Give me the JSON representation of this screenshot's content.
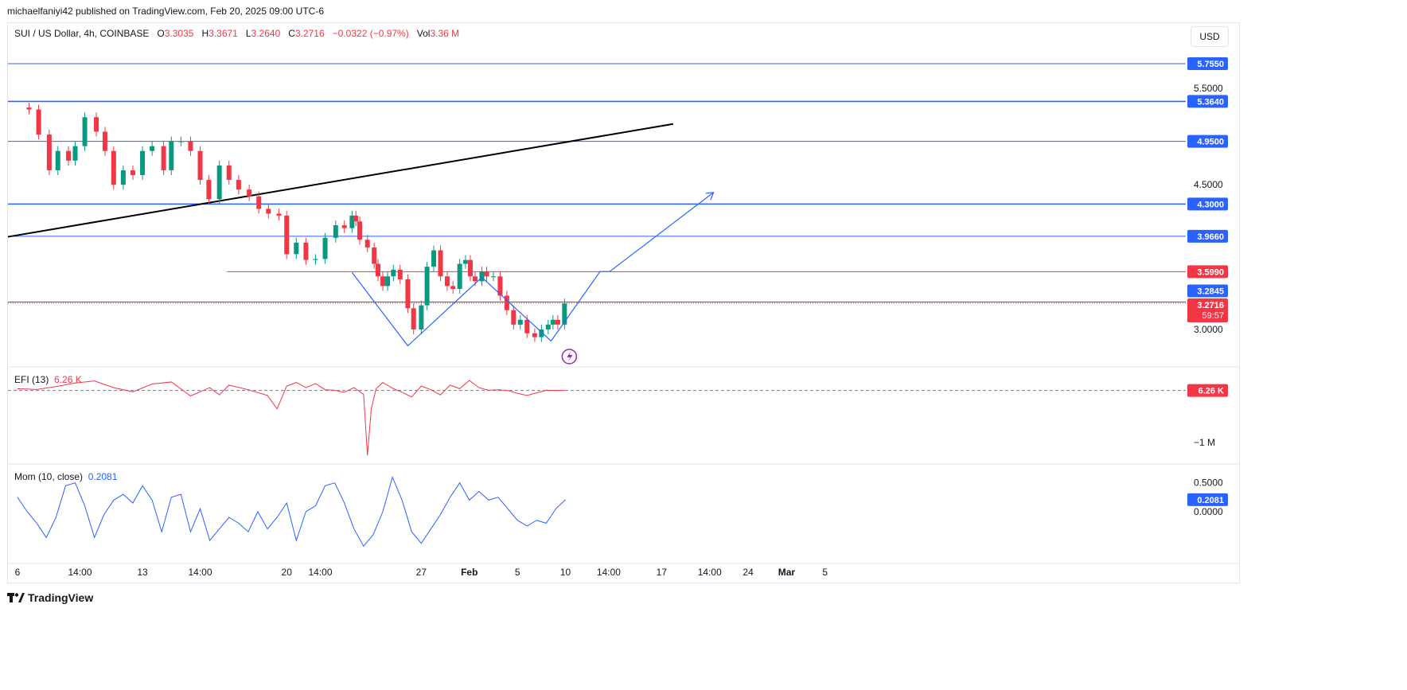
{
  "publisher": "michaelfaniyi42 published on TradingView.com, Feb 20, 2025 09:00 UTC-6",
  "legend": {
    "symbol": "SUI / US Dollar, 4h, COINBASE",
    "o_label": "O",
    "o": "3.3035",
    "h_label": "H",
    "h": "3.3671",
    "l_label": "L",
    "l": "3.2640",
    "c_label": "C",
    "c": "3.2716",
    "change": "−0.0322 (−0.97%)",
    "vol_label": "Vol",
    "vol": "3.36 M"
  },
  "currency_button": "USD",
  "efi": {
    "label": "EFI (13)",
    "value": "6.26 K"
  },
  "mom": {
    "label": "Mom (10, close)",
    "value": "0.2081"
  },
  "footer": {
    "brand": "TradingView",
    "logo": "tradingview-logo-icon"
  },
  "indicator_icon": "lightning-icon",
  "colors": {
    "up": "#089981",
    "down": "#f23645",
    "level": "#2962ff",
    "resistance": "#f23645",
    "trend": "#000000",
    "efi": "#f23645",
    "mom": "#2962ff"
  },
  "chart_data": [
    {
      "type": "candlestick",
      "title": "SUI / US Dollar, 4h, COINBASE",
      "ylim": [
        2.62,
        5.92
      ],
      "y_ticks": [
        "5.5000",
        "4.5000",
        "3.0000"
      ],
      "x_ticks": [
        "6",
        "14:00",
        "13",
        "14:00",
        "20",
        "14:00",
        "27",
        "Feb",
        "5",
        "10",
        "14:00",
        "17",
        "14:00",
        "24",
        "Mar",
        "5"
      ],
      "x_tick_dates": [
        0,
        6.5,
        13,
        19,
        28,
        31.5,
        42,
        47,
        52,
        57,
        61.5,
        67,
        72,
        76,
        80,
        84
      ],
      "horizontal_levels": [
        {
          "label": "5.7550",
          "value": 5.755
        },
        {
          "label": "5.3640",
          "value": 5.364
        },
        {
          "label": "4.9500",
          "value": 4.95
        },
        {
          "label": "4.3000",
          "value": 4.3
        },
        {
          "label": "3.9660",
          "value": 3.966
        }
      ],
      "resistance_line": {
        "label": "3.5990",
        "value": 3.599,
        "from": 21.8
      },
      "current_price": {
        "label": "3.2716",
        "value": 3.2716,
        "countdown": "59:57"
      },
      "blue_tag": {
        "label": "3.2845",
        "value": 3.2845
      },
      "trend_line": {
        "x": [
          0,
          68.2
        ],
        "y": [
          3.96,
          5.13
        ]
      },
      "pattern_path": {
        "x": [
          34.8,
          40.6,
          48.3,
          55.5,
          60.6,
          61.6,
          72.4
        ],
        "y": [
          3.59,
          2.83,
          3.54,
          2.88,
          3.6,
          3.6,
          4.42
        ]
      },
      "close_path": {
        "x": [
          0,
          1.2,
          2.2,
          3.3,
          4.2,
          5.3,
          6.0,
          7.0,
          8.2,
          9.1,
          10.0,
          11.0,
          12.0,
          13.0,
          14.0,
          15.2,
          16.0,
          17.0,
          18.0,
          19.0,
          19.9,
          21.0,
          22.0,
          23.0,
          24.1,
          25.1,
          26.1,
          27.2,
          28.0,
          29.0,
          30.0,
          31.0,
          32.0,
          33.1,
          34.0,
          34.8,
          35.2,
          35.6,
          36.4,
          37.1,
          37.5,
          38.0,
          38.5,
          39.1,
          39.8,
          40.6,
          41.2,
          42.0,
          42.6,
          43.3,
          44.0,
          44.7,
          45.3,
          46.0,
          46.6,
          47.1,
          47.6,
          48.3,
          48.8,
          49.5,
          50.2,
          50.9,
          51.6,
          52.3,
          53.0,
          53.8,
          54.5,
          55.2,
          55.7,
          56.2,
          56.9
        ],
        "y": [
          5.3,
          5.28,
          5.02,
          4.65,
          4.85,
          4.75,
          4.9,
          5.2,
          5.05,
          4.85,
          4.5,
          4.65,
          4.6,
          4.85,
          4.9,
          4.65,
          4.95,
          4.95,
          4.85,
          4.55,
          4.35,
          4.7,
          4.55,
          4.45,
          4.38,
          4.25,
          4.2,
          4.18,
          3.78,
          3.9,
          3.72,
          3.73,
          3.95,
          4.08,
          4.05,
          4.18,
          4.12,
          3.93,
          3.85,
          3.68,
          3.55,
          3.45,
          3.55,
          3.62,
          3.52,
          3.22,
          3.0,
          3.25,
          3.65,
          3.82,
          3.55,
          3.45,
          3.42,
          3.68,
          3.72,
          3.55,
          3.5,
          3.6,
          3.55,
          3.55,
          3.35,
          3.2,
          3.05,
          3.1,
          2.96,
          2.92,
          3.0,
          3.05,
          3.1,
          3.05,
          3.27
        ]
      }
    },
    {
      "type": "line",
      "title": "EFI (13)",
      "ylim": [
        -1400000,
        400000
      ],
      "y_ticks": [
        "−1 M"
      ],
      "zero_line": 6260,
      "series": [
        {
          "name": "EFI (13)",
          "x": [
            0,
            2,
            4,
            6,
            8,
            10,
            12,
            14,
            16,
            18,
            20,
            21,
            22,
            24,
            26,
            27,
            28,
            29,
            30,
            31,
            32,
            33,
            34,
            35,
            36,
            36.4,
            36.8,
            37.3,
            38,
            39,
            40,
            41,
            42,
            43,
            44,
            45,
            46,
            47,
            48,
            49,
            50,
            51,
            52,
            53,
            54,
            55,
            56,
            57
          ],
          "y": [
            40000,
            25000,
            80000,
            150000,
            190000,
            60000,
            -20000,
            130000,
            170000,
            -100000,
            60000,
            -80000,
            110000,
            20000,
            -90000,
            -350000,
            90000,
            160000,
            60000,
            140000,
            20000,
            10000,
            -30000,
            60000,
            -70000,
            -1250000,
            -350000,
            40000,
            160000,
            50000,
            -30000,
            -120000,
            90000,
            20000,
            -80000,
            110000,
            40000,
            200000,
            60000,
            10000,
            20000,
            5000,
            -50000,
            -90000,
            -40000,
            10000,
            6260,
            6260
          ]
        }
      ]
    },
    {
      "type": "line",
      "title": "Mom (10, close)",
      "ylim": [
        -0.9,
        0.8
      ],
      "y_ticks": [
        "0.5000",
        "0.0000"
      ],
      "series": [
        {
          "name": "Mom (10, close)",
          "x": [
            0,
            1,
            2,
            3,
            4,
            5,
            6,
            7,
            8,
            9,
            10,
            11,
            12,
            13,
            14,
            15,
            16,
            17,
            18,
            19,
            20,
            21,
            22,
            23,
            24,
            25,
            26,
            27,
            28,
            29,
            30,
            31,
            32,
            33,
            34,
            35,
            36,
            37,
            38,
            39,
            40,
            41,
            42,
            43,
            44,
            45,
            46,
            47,
            48,
            49,
            50,
            51,
            52,
            53,
            54,
            55,
            56,
            57
          ],
          "y": [
            0.25,
            0.0,
            -0.2,
            -0.45,
            -0.1,
            0.45,
            0.5,
            0.1,
            -0.45,
            -0.05,
            0.2,
            0.3,
            0.15,
            0.45,
            0.2,
            -0.35,
            0.25,
            0.3,
            -0.35,
            0.05,
            -0.5,
            -0.3,
            -0.1,
            -0.2,
            -0.35,
            0.0,
            -0.3,
            -0.1,
            0.15,
            -0.5,
            0.0,
            0.1,
            0.45,
            0.5,
            0.15,
            -0.3,
            -0.6,
            -0.4,
            0.0,
            0.6,
            0.2,
            -0.35,
            -0.55,
            -0.3,
            -0.05,
            0.25,
            0.5,
            0.2,
            0.35,
            0.2,
            0.25,
            0.05,
            -0.15,
            -0.25,
            -0.15,
            -0.2,
            0.05,
            0.2081
          ]
        }
      ]
    }
  ]
}
